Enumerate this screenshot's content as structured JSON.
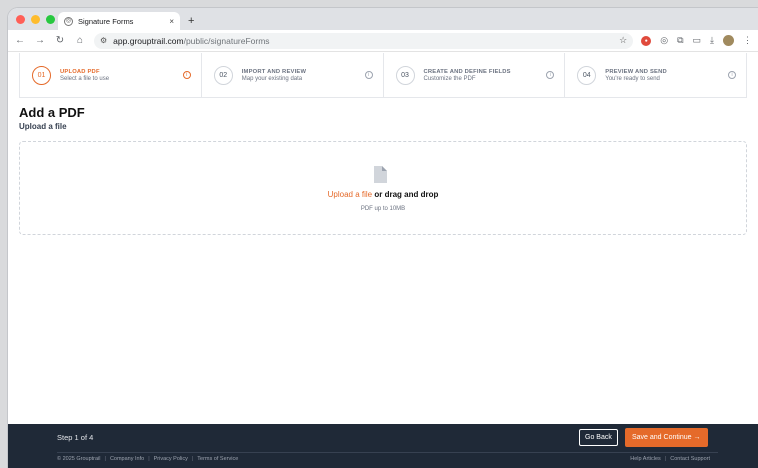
{
  "browser": {
    "tab_title": "Signature Forms",
    "tab_close": "×",
    "new_tab": "+",
    "url_host": "app.grouptrail.com",
    "url_path": "/public/signatureForms"
  },
  "steps": [
    {
      "num": "01",
      "title": "UPLOAD PDF",
      "subtitle": "Select a file to use",
      "active": true
    },
    {
      "num": "02",
      "title": "IMPORT AND REVIEW",
      "subtitle": "Map your existing data",
      "active": false
    },
    {
      "num": "03",
      "title": "CREATE AND DEFINE FIELDS",
      "subtitle": "Customize the PDF",
      "active": false
    },
    {
      "num": "04",
      "title": "PREVIEW AND SEND",
      "subtitle": "You're ready to send",
      "active": false
    }
  ],
  "page": {
    "title": "Add a PDF",
    "subtitle": "Upload a file"
  },
  "dropzone": {
    "link_text": "Upload a file",
    "rest_text": " or drag and drop",
    "hint": "PDF up to 10MB"
  },
  "footer": {
    "step_count": "Step 1 of 4",
    "back_label": "Go Back",
    "save_label": "Save and Continue →",
    "copyright": "© 2025 Grouptrail",
    "company_info": "Company Info",
    "privacy": "Privacy Policy",
    "terms": "Terms of Service",
    "help": "Help Articles",
    "contact": "Contact Support",
    "separator": "|"
  },
  "colors": {
    "accent": "#e56a2a",
    "footer_bg": "#1f2937"
  }
}
